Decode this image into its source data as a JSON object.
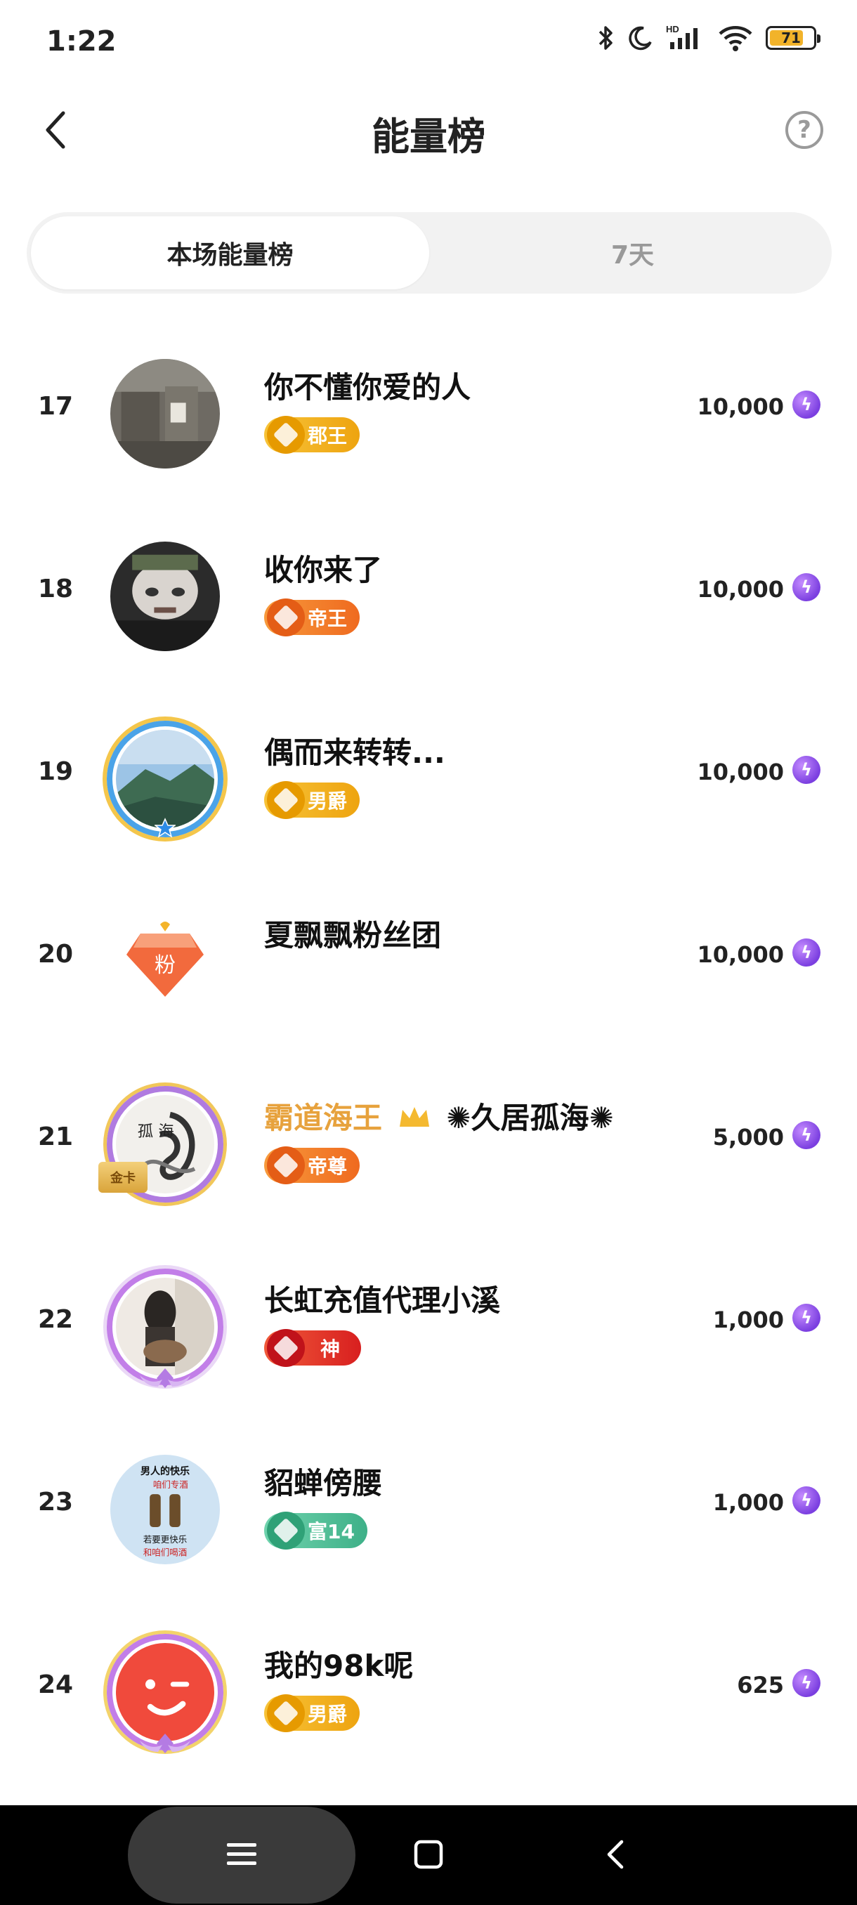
{
  "status_bar": {
    "time": "1:22",
    "battery_level": "71",
    "hd_label": "HD"
  },
  "header": {
    "title": "能量榜",
    "help_symbol": "?"
  },
  "tabs": [
    {
      "label": "本场能量榜",
      "active": true
    },
    {
      "label": "7天",
      "active": false
    }
  ],
  "colors": {
    "gold_name": "#e7a23d",
    "badge_gold": "#f3b11e",
    "badge_orange": "#f27a2a",
    "badge_red": "#e4312b",
    "badge_green": "#4fbf96",
    "energy": "#7b3fe0"
  },
  "ranking": [
    {
      "rank": "17",
      "name": "你不懂你爱的人",
      "badge": "郡王",
      "badge_style": "gold",
      "score": "10,000",
      "avatar": "stone-wall-photo"
    },
    {
      "rank": "18",
      "name": "收你来了",
      "badge": "帝王",
      "badge_style": "orange",
      "score": "10,000",
      "avatar": "man-face-photo"
    },
    {
      "rank": "19",
      "name": "偶而来转转...",
      "badge": "男爵",
      "badge_style": "gold",
      "score": "10,000",
      "avatar": "mountain-landscape-photo"
    },
    {
      "rank": "20",
      "name": "夏飘飘粉丝团",
      "badge": "",
      "badge_style": "none",
      "score": "10,000",
      "avatar": "fan-club-diamond",
      "avatar_text": "粉"
    },
    {
      "rank": "21",
      "name_gold": "霸道海王",
      "name_rest": "✺久居孤海✺",
      "badge": "帝尊",
      "badge_style": "orange",
      "score": "5,000",
      "avatar": "ink-dragon-art",
      "avatar_text": "孤 海",
      "card_text": "金卡"
    },
    {
      "rank": "22",
      "name": "长虹充值代理小溪",
      "badge": "神",
      "badge_style": "red",
      "score": "1,000",
      "avatar": "guitar-girl-photo"
    },
    {
      "rank": "23",
      "name": "貂蝉傍腰",
      "badge": "富14",
      "badge_style": "green",
      "score": "1,000",
      "avatar": "beer-poster",
      "avatar_lines": [
        "男人的快乐",
        "咱们专酒",
        "若要更快乐",
        "和咱们喝酒"
      ]
    },
    {
      "rank": "24",
      "name": "我的98k呢",
      "badge": "男爵",
      "badge_style": "gold",
      "score": "625",
      "avatar": "red-winking-face"
    }
  ]
}
